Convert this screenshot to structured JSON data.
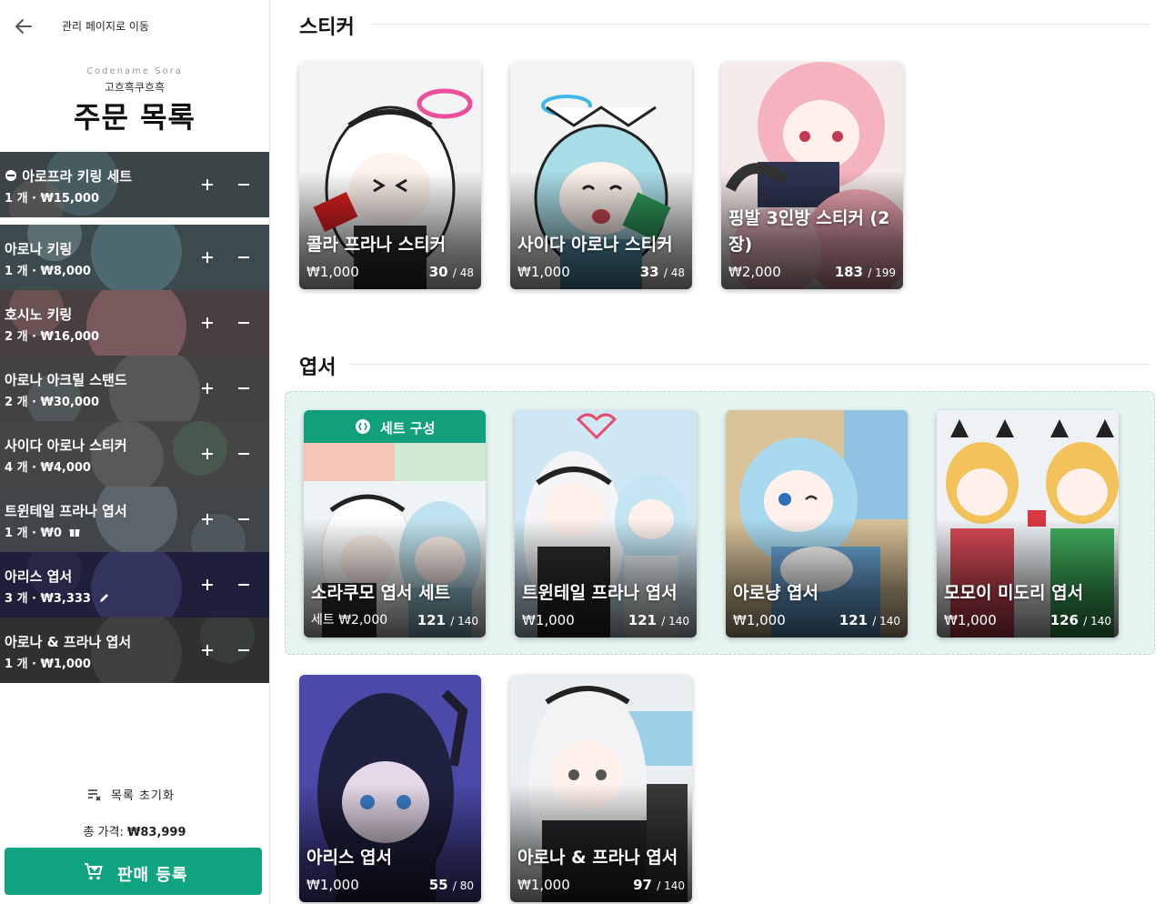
{
  "sidebar": {
    "back_label": "관리 페이지로 이동",
    "codename": "Codename Sora",
    "shop_name": "고흐흑쿠흐흑",
    "title": "주문 목록",
    "orders": [
      {
        "icon": "coupon-icon",
        "name": "아로프라 키링 세트",
        "detail": "1 개 · ₩15,000"
      },
      {
        "name": "아로나 키링",
        "detail": "1 개 · ₩8,000"
      },
      {
        "name": "호시노 키링",
        "detail": "2 개 · ₩16,000"
      },
      {
        "name": "아로나 아크릴 스탠드",
        "detail": "2 개 · ₩30,000"
      },
      {
        "name": "사이다 아로나 스티커",
        "detail": "4 개 · ₩4,000"
      },
      {
        "name": "트윈테일 프라나 엽서",
        "detail": "1 개 · ₩0",
        "badge_icon": "gift-icon"
      },
      {
        "name": "아리스 엽서",
        "detail": "3 개 · ₩3,333",
        "badge_icon": "pencil-icon"
      },
      {
        "name": "아로나 & 프라나 엽서",
        "detail": "1 개 · ₩1,000"
      }
    ],
    "reset_label": "목록 초기화",
    "total_label": "총 가격:",
    "total_value": "₩83,999",
    "register_label": "판매 등록"
  },
  "sections": {
    "stickers": {
      "title": "스티커",
      "cards": [
        {
          "title": "콜라 프라나 스티커",
          "price": "₩1,000",
          "stock": "30",
          "total": "/ 48"
        },
        {
          "title": "사이다 아로나 스티커",
          "price": "₩1,000",
          "stock": "33",
          "total": "/ 48"
        },
        {
          "title": "핑발 3인방 스티커 (2장)",
          "price": "₩2,000",
          "stock": "183",
          "total": "/ 199"
        }
      ]
    },
    "postcards": {
      "title": "엽서",
      "set_banner": "세트 구성",
      "set_cards": [
        {
          "title": "소라쿠모 엽서 세트",
          "price": "세트  ₩2,000",
          "stock": "121",
          "total": "/ 140"
        },
        {
          "title": "트윈테일 프라나 엽서",
          "price": "₩1,000",
          "stock": "121",
          "total": "/ 140"
        },
        {
          "title": "아로냥 엽서",
          "price": "₩1,000",
          "stock": "121",
          "total": "/ 140"
        },
        {
          "title": "모모이 미도리 엽서",
          "price": "₩1,000",
          "stock": "126",
          "total": "/ 140"
        }
      ],
      "cards": [
        {
          "title": "아리스 엽서",
          "price": "₩1,000",
          "stock": "55",
          "total": "/ 80"
        },
        {
          "title": "아로나 & 프라나 엽서",
          "price": "₩1,000",
          "stock": "97",
          "total": "/ 140"
        }
      ]
    }
  },
  "colors": {
    "accent": "#10a37f",
    "set_panel_bg": "#e6f4f1"
  }
}
